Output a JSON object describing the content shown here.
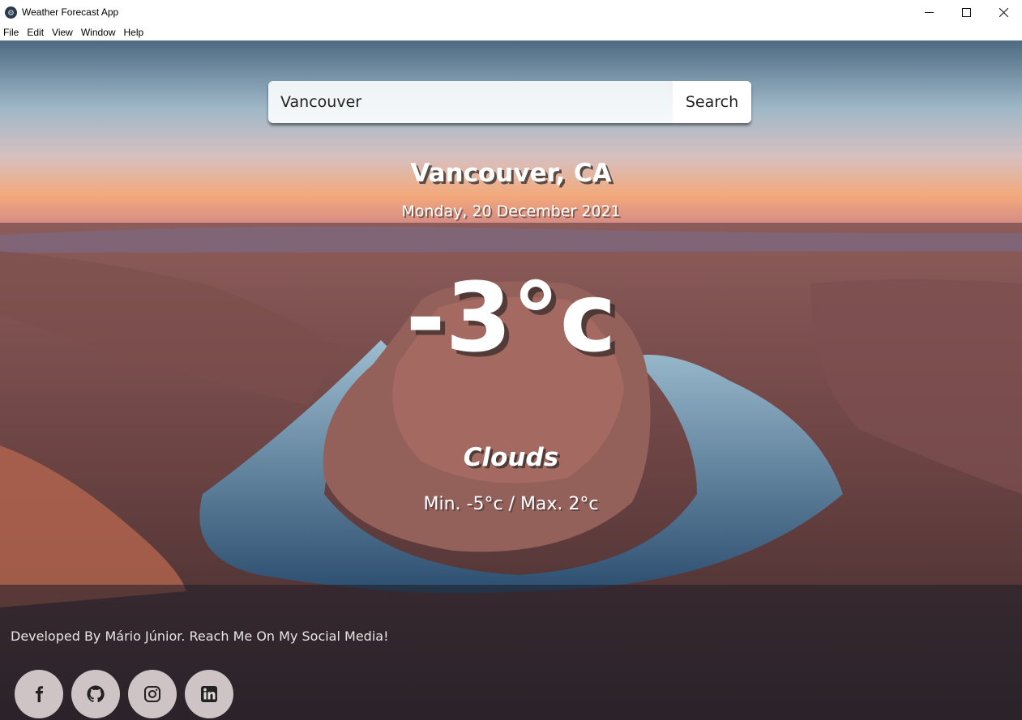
{
  "window": {
    "title": "Weather Forecast App",
    "minimize": "—",
    "close": "✕"
  },
  "menu": [
    "File",
    "Edit",
    "View",
    "Window",
    "Help"
  ],
  "search": {
    "value": "Vancouver",
    "button_label": "Search"
  },
  "weather": {
    "location": "Vancouver, CA",
    "date": "Monday, 20 December 2021",
    "temperature": "-3°c",
    "condition": "Clouds",
    "min_max": "Min. -5°c / Max. 2°c"
  },
  "footer": {
    "credit": "Developed By Mário Júnior. Reach Me On My Social Media!",
    "socials": [
      {
        "icon": "facebook-icon"
      },
      {
        "icon": "github-icon"
      },
      {
        "icon": "instagram-icon"
      },
      {
        "icon": "linkedin-icon"
      }
    ]
  }
}
